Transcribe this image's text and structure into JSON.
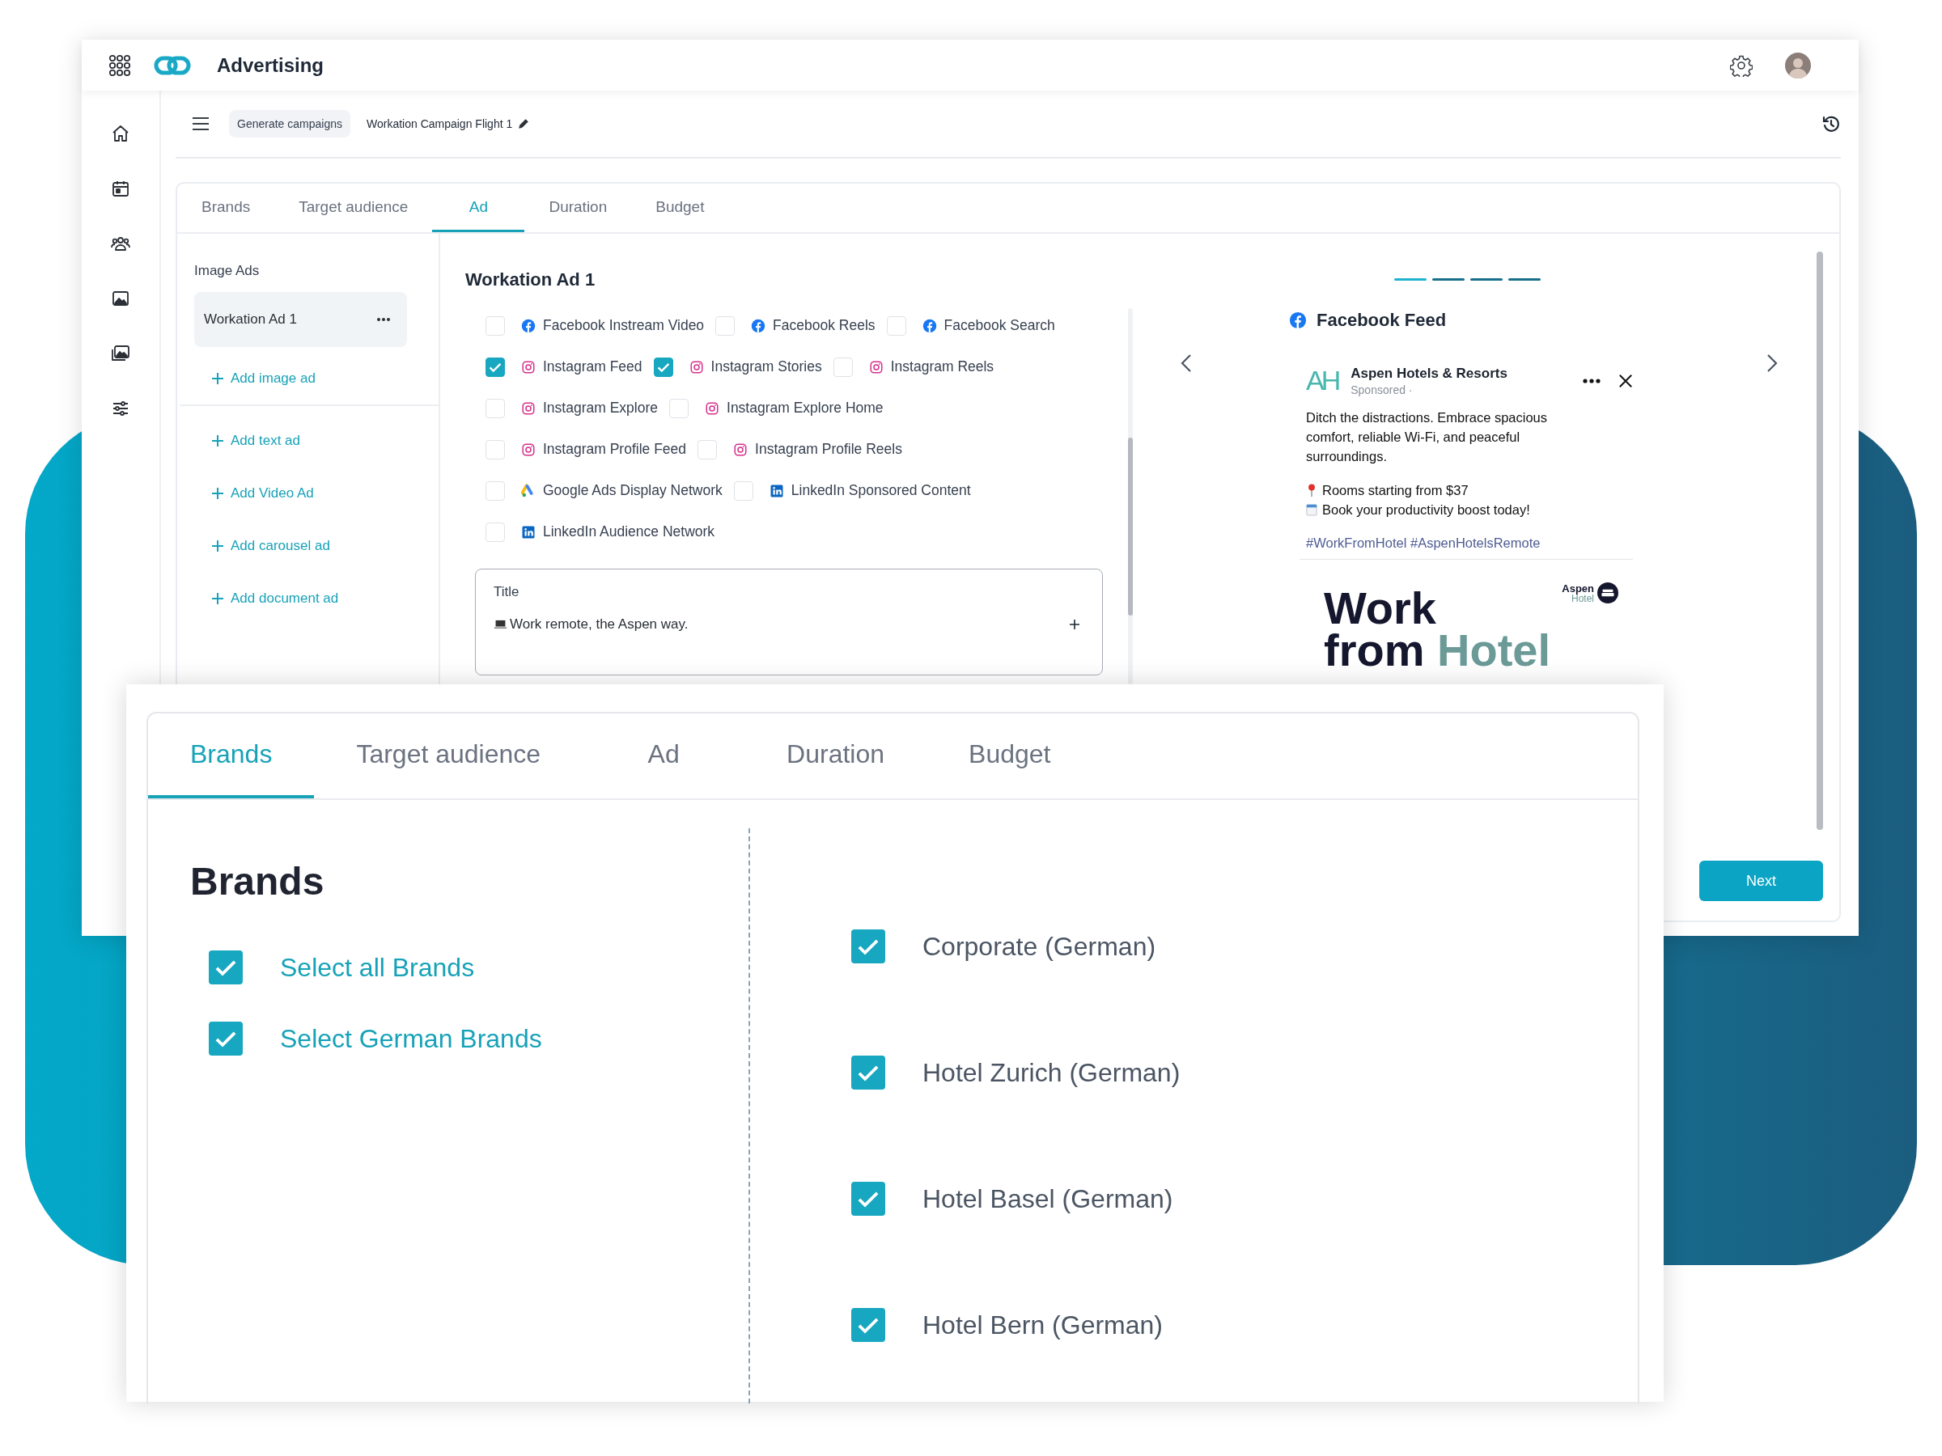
{
  "app": {
    "title": "Advertising"
  },
  "breadcrumb": {
    "chip": "Generate campaigns",
    "campaign": "Workation Campaign Flight 1"
  },
  "tabs": [
    {
      "label": "Brands",
      "selected": false
    },
    {
      "label": "Target audience",
      "selected": false
    },
    {
      "label": "Ad",
      "selected": true
    },
    {
      "label": "Duration",
      "selected": false
    },
    {
      "label": "Budget",
      "selected": false
    }
  ],
  "image_ads": {
    "heading": "Image Ads",
    "items": [
      {
        "label": "Workation Ad 1",
        "selected": true
      }
    ],
    "add_label": "Add image ad"
  },
  "add_actions": [
    {
      "label": "Add text ad"
    },
    {
      "label": "Add Video Ad"
    },
    {
      "label": "Add carousel ad"
    },
    {
      "label": "Add document ad"
    }
  ],
  "ad": {
    "heading": "Workation Ad 1",
    "placement_rows": [
      {
        "items": [
          {
            "label": "Facebook Instream Video",
            "kind": "facebook",
            "checked": false
          },
          {
            "label": "Facebook Reels",
            "kind": "facebook",
            "checked": false
          },
          {
            "label": "Facebook Search",
            "kind": "facebook",
            "checked": false
          }
        ]
      },
      {
        "items": [
          {
            "label": "Instagram Feed",
            "kind": "instagram",
            "checked": true
          },
          {
            "label": "Instagram Stories",
            "kind": "instagram",
            "checked": true
          },
          {
            "label": "Instagram Reels",
            "kind": "instagram",
            "checked": false
          }
        ]
      },
      {
        "items": [
          {
            "label": "Instagram Explore",
            "kind": "instagram",
            "checked": false
          },
          {
            "label": "Instagram Explore Home",
            "kind": "instagram",
            "checked": false
          }
        ]
      },
      {
        "items": [
          {
            "label": "Instagram Profile Feed",
            "kind": "instagram",
            "checked": false
          },
          {
            "label": "Instagram Profile Reels",
            "kind": "instagram",
            "checked": false
          }
        ]
      },
      {
        "items": [
          {
            "label": "Google Ads Display Network",
            "kind": "google",
            "checked": false
          },
          {
            "label": "LinkedIn Sponsored Content",
            "kind": "linkedin",
            "checked": false
          }
        ]
      },
      {
        "items": [
          {
            "label": "LinkedIn Audience Network",
            "kind": "linkedin",
            "checked": false
          }
        ]
      }
    ],
    "title_field": {
      "label": "Title",
      "value": "Work remote, the Aspen way."
    }
  },
  "preview": {
    "slides": [
      {
        "selected": true
      },
      {
        "selected": false
      },
      {
        "selected": false
      },
      {
        "selected": false
      }
    ],
    "heading": "Facebook Feed",
    "logo": "AH",
    "advertiser": "Aspen Hotels & Resorts",
    "sponsored": "Sponsored ·",
    "body": "Ditch the distractions. Embrace spacious comfort, reliable Wi-Fi, and peaceful surroundings.",
    "lines": [
      {
        "kind": "pin",
        "text": "Rooms starting from $37"
      },
      {
        "kind": "calendar",
        "text": "Book your productivity boost today!"
      }
    ],
    "hashtags": "#WorkFromHotel #AspenHotelsRemote",
    "image": {
      "headline": "Work",
      "headline_2": "from",
      "headline_accent": "Hotel",
      "brand": "Aspen",
      "brand_sub": "Hotel"
    }
  },
  "next_button": "Next",
  "brands_panel": {
    "tabs": [
      {
        "label": "Brands",
        "selected": true
      },
      {
        "label": "Target audience",
        "selected": false
      },
      {
        "label": "Ad",
        "selected": false
      },
      {
        "label": "Duration",
        "selected": false
      },
      {
        "label": "Budget",
        "selected": false
      }
    ],
    "heading": "Brands",
    "groups": [
      {
        "label": "Select all Brands",
        "checked": true
      },
      {
        "label": "Select German Brands",
        "checked": true
      }
    ],
    "brands": [
      {
        "label": "Corporate (German)",
        "checked": true
      },
      {
        "label": "Hotel Zurich (German)",
        "checked": true
      },
      {
        "label": "Hotel Basel (German)",
        "checked": true
      },
      {
        "label": "Hotel Bern (German)",
        "checked": true
      }
    ]
  }
}
